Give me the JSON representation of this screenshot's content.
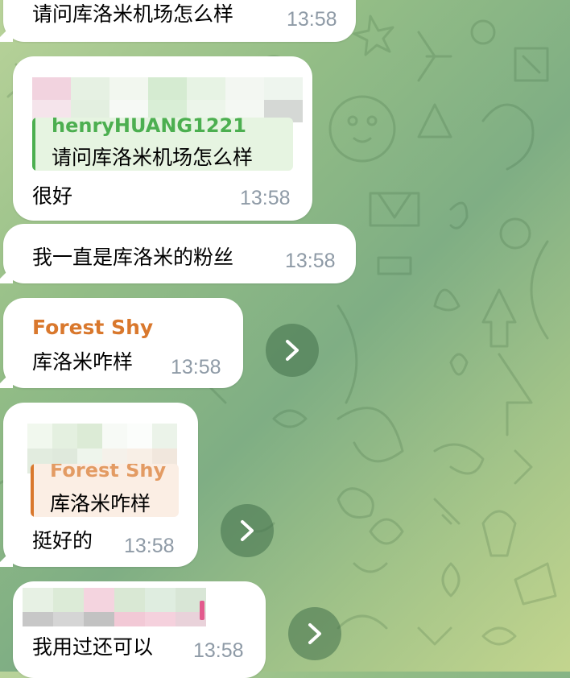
{
  "messages": [
    {
      "id": "m1",
      "text": "请问库洛米机场怎么样",
      "time": "13:58"
    },
    {
      "id": "m2",
      "sender_pixelated": true,
      "reply": {
        "name": "henryHUANG1221",
        "text": "请问库洛米机场怎么样",
        "color": "#4caf50"
      },
      "text": "很好",
      "time": "13:58"
    },
    {
      "id": "m3",
      "text": "我一直是库洛米的粉丝",
      "time": "13:58"
    },
    {
      "id": "m4",
      "sender": "Forest Shy",
      "sender_color": "#d9782d",
      "text": "库洛米咋样",
      "time": "13:58"
    },
    {
      "id": "m5",
      "sender_pixelated": true,
      "reply": {
        "name": "Forest Shy",
        "text": "库洛米咋样",
        "color": "#d9782d"
      },
      "text": "挺好的",
      "time": "13:58"
    },
    {
      "id": "m6",
      "sender_pixelated": true,
      "text": "我用过还可以",
      "time": "13:58"
    }
  ],
  "icons": {
    "forward": "forward-arrow-icon"
  },
  "colors": {
    "time": "#8e9aa6",
    "bubble": "#ffffff",
    "forward_button": "#42704a"
  }
}
